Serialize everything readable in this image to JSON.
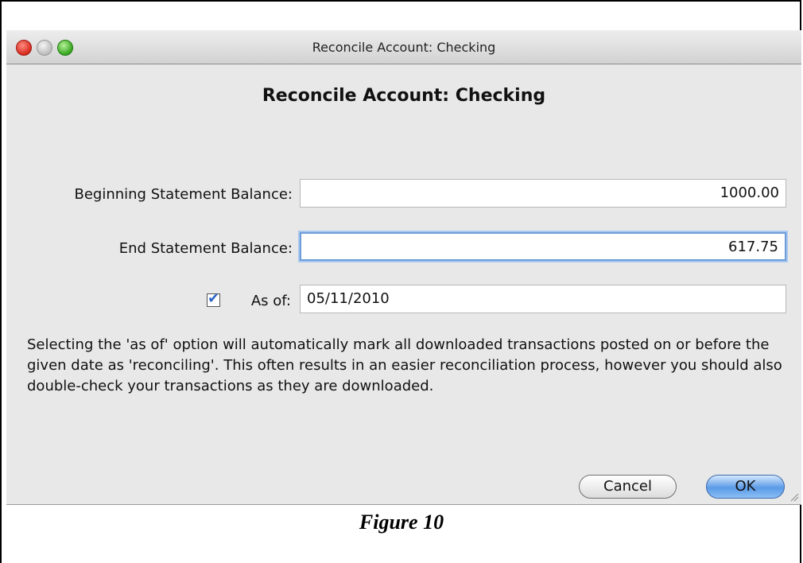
{
  "window": {
    "title": "Reconcile Account: Checking"
  },
  "dialog": {
    "heading": "Reconcile Account: Checking",
    "beginning_balance": {
      "label": "Beginning Statement Balance:",
      "value": "1000.00"
    },
    "end_balance": {
      "label": "End Statement Balance:",
      "value": "617.75"
    },
    "as_of": {
      "label": "As of:",
      "checked": true,
      "value": "05/11/2010"
    },
    "description": "Selecting the 'as of' option will automatically mark all downloaded transactions posted on or before the given date as 'reconciling'.  This often results in an easier reconciliation process, however you should also double-check your transactions as they are downloaded.",
    "buttons": {
      "cancel": "Cancel",
      "ok": "OK"
    }
  },
  "caption": "Figure 10",
  "colors": {
    "window_bg": "#e8e8e8",
    "ok_button": "#5a9ae6",
    "focus_ring": "#6d9dd8"
  }
}
